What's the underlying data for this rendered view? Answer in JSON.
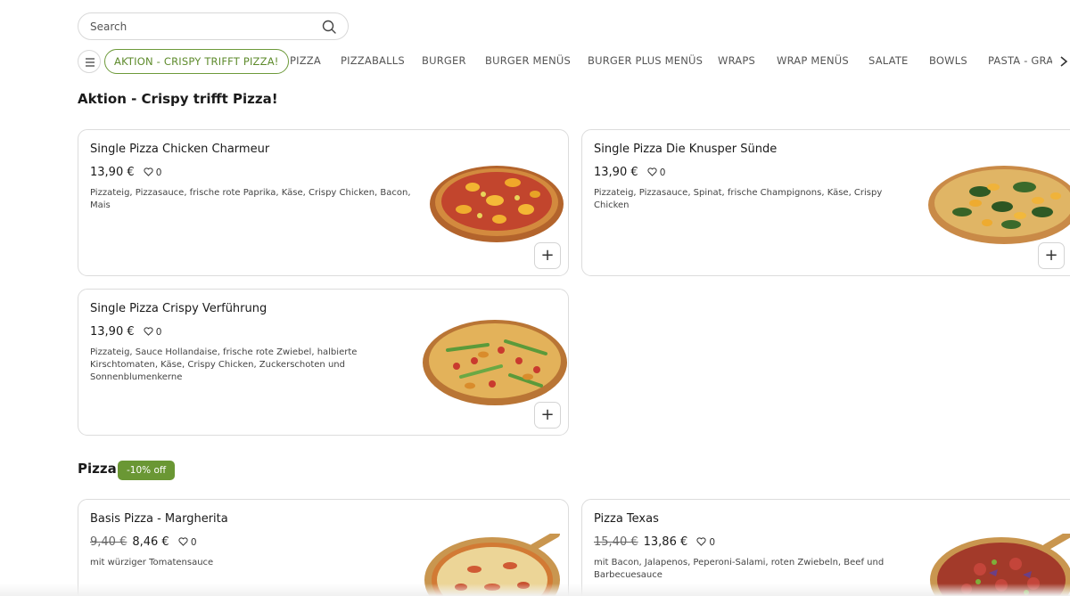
{
  "search": {
    "placeholder": "Search"
  },
  "categories": [
    "AKTION - CRISPY TRIFFT PIZZA!",
    "PIZZA",
    "PIZZABALLS",
    "BURGER",
    "BURGER MENÜS",
    "BURGER PLUS MENÜS",
    "WRAPS",
    "WRAP MENÜS",
    "SALATE",
    "BOWLS",
    "PASTA - GRA"
  ],
  "active_category": "AKTION - CRISPY TRIFFT PIZZA!",
  "sections": [
    {
      "title": "Aktion - Crispy trifft Pizza!",
      "badge": "",
      "products": [
        {
          "name": "Single Pizza Chicken Charmeur",
          "old_price": "",
          "price": "13,90 €",
          "likes": "0",
          "description": "Pizzateig, Pizzasauce, frische rote Paprika, Käse, Crispy Chicken, Bacon, Mais"
        },
        {
          "name": "Single Pizza Die Knusper Sünde",
          "old_price": "",
          "price": "13,90 €",
          "likes": "0",
          "description": "Pizzateig, Pizzasauce, Spinat, frische Champignons, Käse, Crispy Chicken"
        },
        {
          "name": "Single Pizza Crispy Verführung",
          "old_price": "",
          "price": "13,90 €",
          "likes": "0",
          "description": "Pizzateig, Sauce Hollandaise, frische rote Zwiebel, halbierte Kirschtomaten, Käse, Crispy Chicken, Zuckerschoten und Sonnenblumenkerne"
        }
      ]
    },
    {
      "title": "Pizza",
      "badge": "-10% off",
      "products": [
        {
          "name": "Basis Pizza - Margherita",
          "old_price": "9,40 €",
          "price": "8,46 €",
          "likes": "0",
          "description": "mit würziger Tomatensauce"
        },
        {
          "name": "Pizza Texas",
          "old_price": "15,40 €",
          "price": "13,86 €",
          "likes": "0",
          "description": "mit Bacon, Jalapenos, Peperoni-Salami, roten Zwiebeln, Beef und Barbecuesauce"
        }
      ]
    }
  ],
  "icons": {
    "search": "search-icon",
    "menu": "hamburger-menu-icon",
    "next": "chevron-right-icon",
    "like": "heart-outline-icon",
    "add": "plus-icon"
  },
  "colors": {
    "accent": "#6a9734",
    "accent_text": "#5e8b2c",
    "border": "#dcdcdc"
  },
  "add_label": "+"
}
